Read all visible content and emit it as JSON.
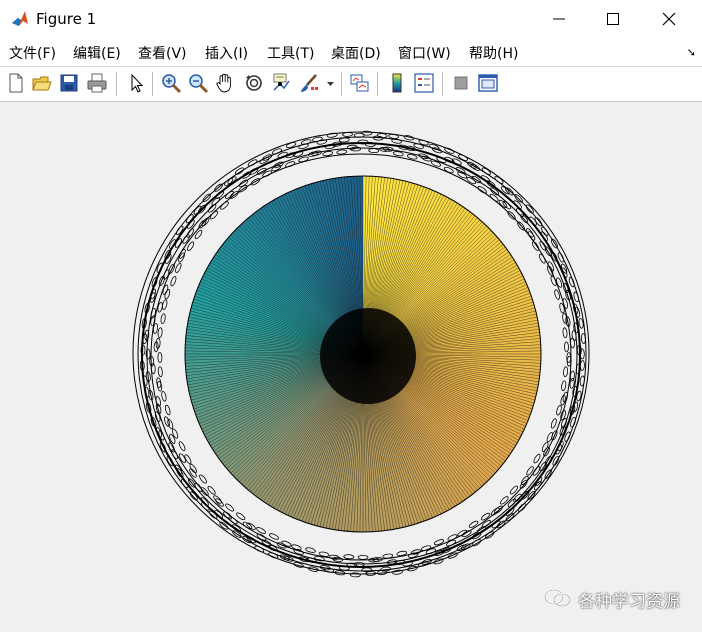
{
  "window": {
    "title": "Figure 1"
  },
  "menu": [
    {
      "label": "文件(F)"
    },
    {
      "label": "编辑(E)"
    },
    {
      "label": "查看(V)"
    },
    {
      "label": "插入(I)"
    },
    {
      "label": "工具(T)"
    },
    {
      "label": "桌面(D)"
    },
    {
      "label": "窗口(W)"
    },
    {
      "label": "帮助(H)"
    }
  ],
  "toolbar": [
    {
      "icon": "new-figure-icon"
    },
    {
      "icon": "open-file-icon"
    },
    {
      "icon": "save-icon"
    },
    {
      "icon": "print-icon"
    },
    {
      "icon": "edit-plot-arrow-icon"
    },
    {
      "icon": "zoom-in-icon"
    },
    {
      "icon": "zoom-out-icon"
    },
    {
      "icon": "pan-hand-icon"
    },
    {
      "icon": "rotate-3d-icon"
    },
    {
      "icon": "data-cursor-icon"
    },
    {
      "icon": "brush-icon"
    },
    {
      "icon": "link-plot-icon"
    },
    {
      "icon": "colorbar-icon"
    },
    {
      "icon": "legend-icon"
    },
    {
      "icon": "hide-plot-tools-icon"
    },
    {
      "icon": "show-plot-tools-icon"
    }
  ],
  "colors": {
    "pie_start": "#ffe640",
    "pie_mid": "#e3a84a",
    "pie_cool": "#21a0a0",
    "pie_end": "#1f5f8c",
    "edge": "#000000"
  },
  "chart_data": {
    "type": "pie",
    "title": "",
    "slice_count": 360,
    "slices": "many (several hundred) thin slices, each with a black edge; colour map runs clockwise from yellow at the top through orange/tan, grey-olive, teal to blue",
    "labels": "one small unreadable text label per slice, overlapping into a thick black ring outside the pie"
  },
  "watermark": {
    "text": "各种学习资源"
  }
}
